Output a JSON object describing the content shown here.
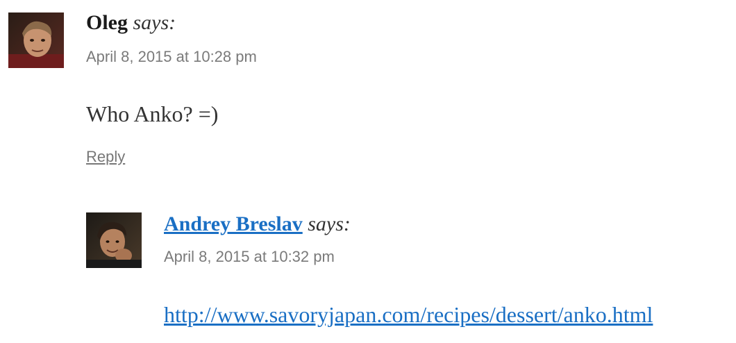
{
  "comments": [
    {
      "author": "Oleg",
      "says": "says:",
      "timestamp": "April 8, 2015 at 10:28 pm",
      "text": "Who Anko? =)",
      "reply_label": "Reply",
      "avatar_icon": "user-photo-avatar"
    },
    {
      "author": "Andrey Breslav",
      "says": "says:",
      "timestamp": "April 8, 2015 at 10:32 pm",
      "link": "http://www.savoryjapan.com/recipes/dessert/anko.html",
      "avatar_icon": "user-photo-avatar"
    }
  ],
  "colors": {
    "link": "#1a6fc4",
    "timestamp": "#7a7a7a",
    "text": "#333333"
  }
}
